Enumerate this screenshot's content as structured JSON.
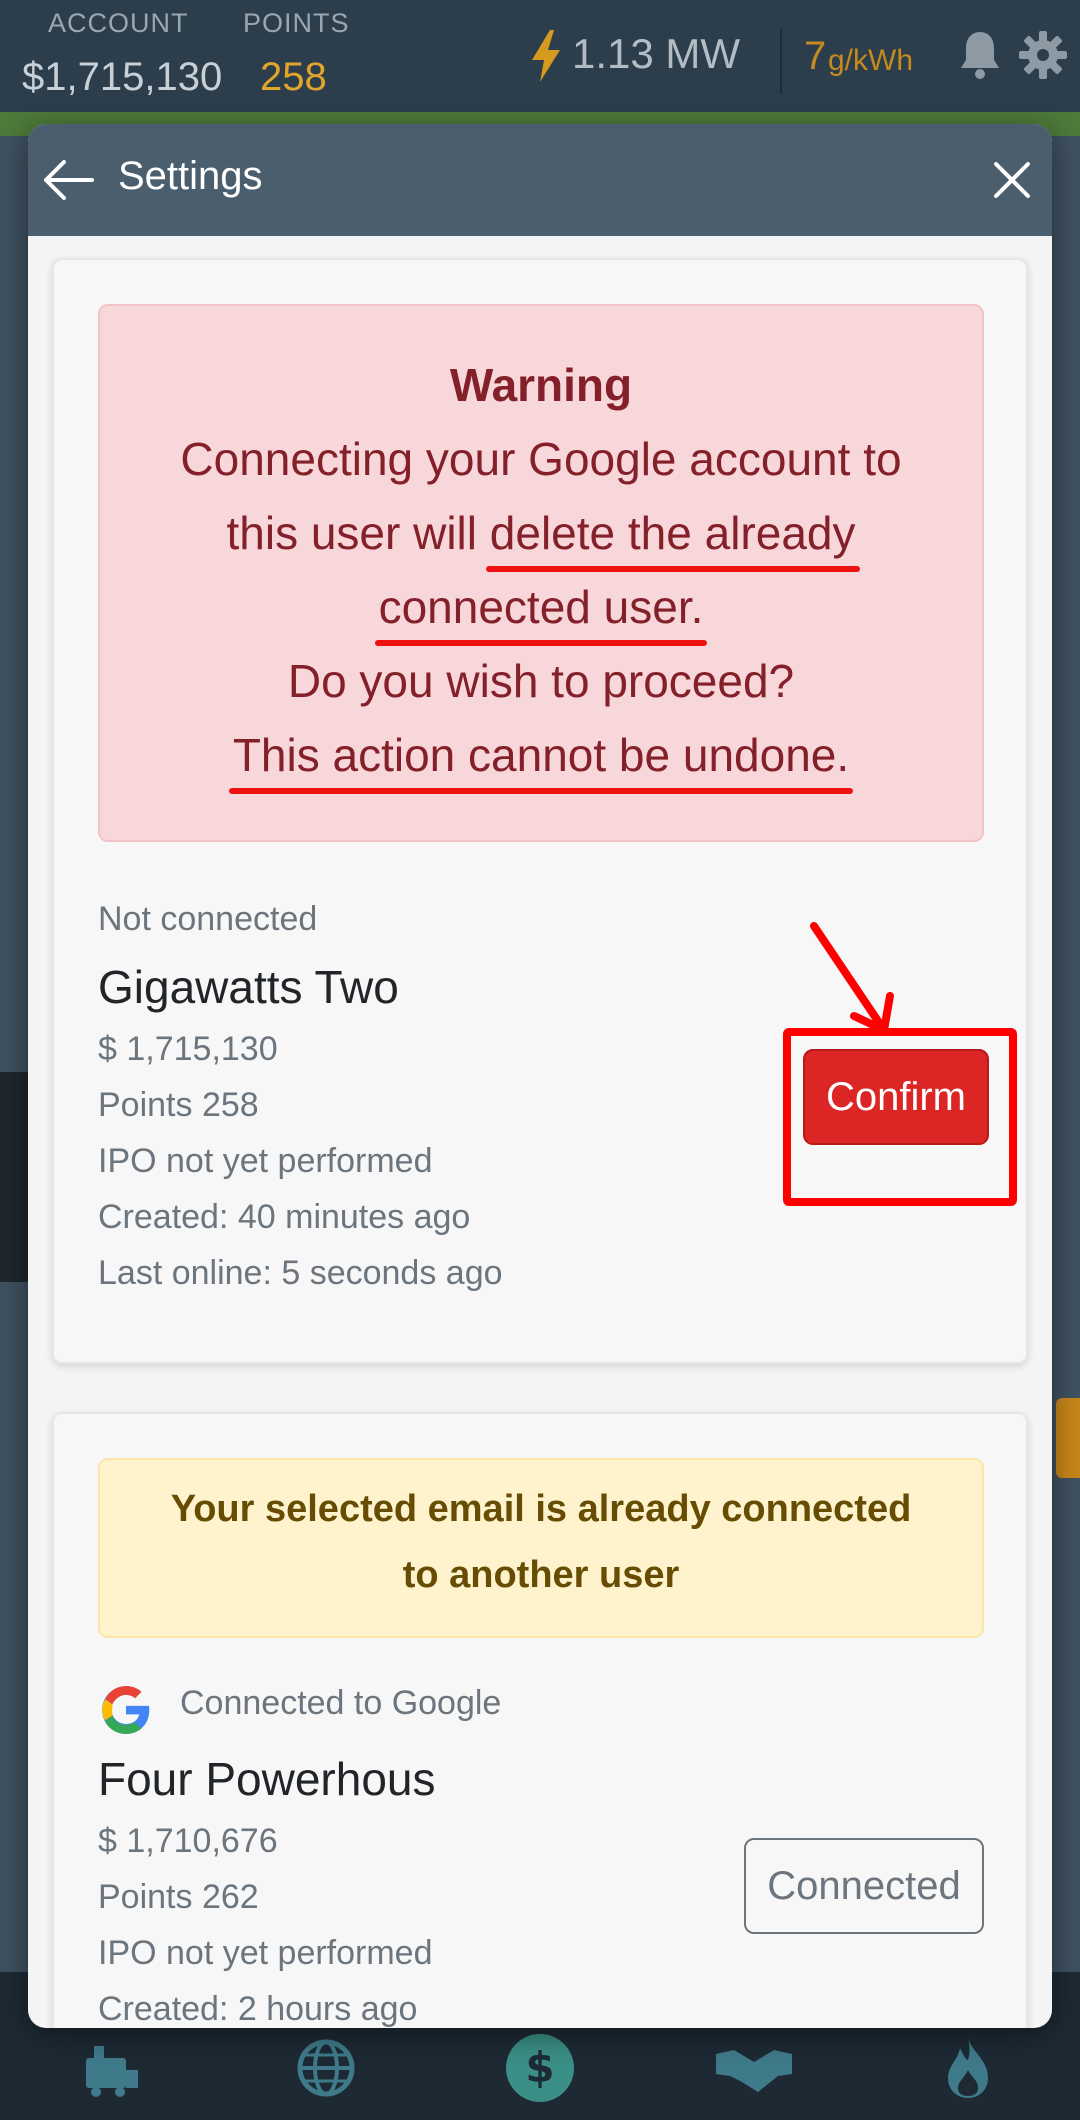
{
  "topbar": {
    "account_label": "ACCOUNT",
    "account_value": "$1,715,130",
    "points_label": "POINTS",
    "points_value": "258",
    "power_value": "1.13 MW",
    "co2_value": "7",
    "co2_unit": "g/kWh"
  },
  "modal": {
    "title": "Settings"
  },
  "warning_alert": {
    "title": "Warning",
    "line1": "Connecting your Google account to",
    "line2_prefix": "this user will ",
    "line2_underlined": "delete the already",
    "line3_underlined": "connected user.",
    "line4": "Do you wish to proceed?",
    "line5_underlined": "This action cannot be undone."
  },
  "current_user": {
    "status": "Not connected",
    "name": "Gigawatts Two",
    "money": "$ 1,715,130",
    "points": "Points 258",
    "ipo": "IPO not yet performed",
    "created": "Created: 40 minutes ago",
    "last_online": "Last online: 5 seconds ago",
    "confirm_label": "Confirm"
  },
  "email_alert": {
    "line1": "Your selected email is already connected",
    "line2": "to another user"
  },
  "connected_user": {
    "status": "Connected to Google",
    "name": "Four Powerhous",
    "money": "$ 1,710,676",
    "points": "Points 262",
    "ipo": "IPO not yet performed",
    "created": "Created: 2 hours ago",
    "button_label": "Connected"
  },
  "colors": {
    "danger": "#dc2626",
    "warning_text": "#664d03",
    "points_gold": "#e0a52a",
    "annotation_red": "#ff0000"
  },
  "icons": [
    "power-bolt-icon",
    "bell-icon",
    "gear-icon",
    "back-arrow-icon",
    "close-icon",
    "google-icon",
    "factory-icon",
    "globe-icon",
    "dollar-icon",
    "handshake-icon",
    "flame-icon"
  ]
}
